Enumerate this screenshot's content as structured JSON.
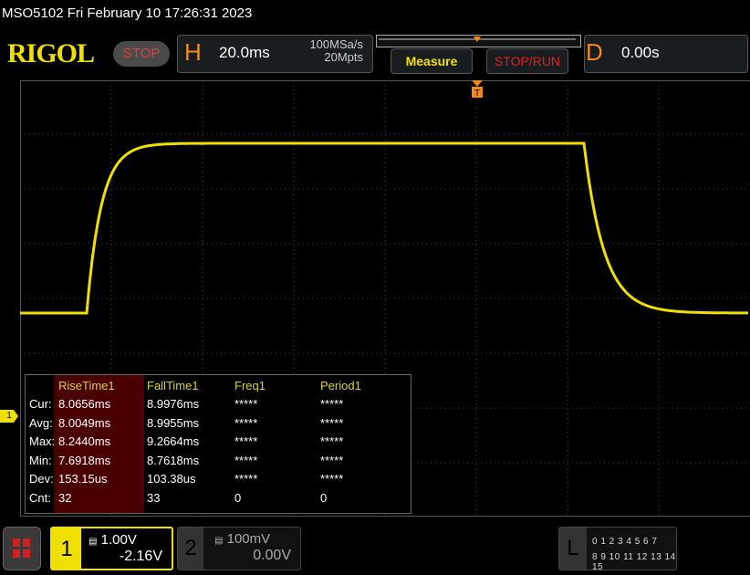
{
  "header": {
    "title": "MSO5102  Fri February 10 17:26:31 2023",
    "logo": "RIGOL",
    "run_state": "STOP"
  },
  "horizontal": {
    "label": "H",
    "timebase": "20.0ms",
    "sample_rate": "100MSa/s",
    "memory_depth": "20Mpts"
  },
  "buttons": {
    "measure": "Measure",
    "stop_run": "STOP/RUN"
  },
  "delay": {
    "label": "D",
    "value": "0.00s"
  },
  "trigger_marker": "T",
  "measurements": {
    "row_labels": [
      "Cur:",
      "Avg:",
      "Max:",
      "Min:",
      "Dev:",
      "Cnt:"
    ],
    "columns": [
      {
        "header": "RiseTime1",
        "values": [
          "8.0656ms",
          "8.0049ms",
          "8.2440ms",
          "7.6918ms",
          "153.15us",
          "32"
        ]
      },
      {
        "header": "FallTime1",
        "values": [
          "8.9976ms",
          "8.9955ms",
          "9.2664ms",
          "8.7618ms",
          "103.38us",
          "33"
        ]
      },
      {
        "header": "Freq1",
        "values": [
          "*****",
          "*****",
          "*****",
          "*****",
          "*****",
          "0"
        ]
      },
      {
        "header": "Period1",
        "values": [
          "*****",
          "*****",
          "*****",
          "*****",
          "*****",
          "0"
        ]
      }
    ]
  },
  "channels": [
    {
      "num": "1",
      "coupling_icon": "dc-coupling-icon",
      "scale": "1.00V",
      "offset": "-2.16V",
      "color": "#f0e000",
      "active": true
    },
    {
      "num": "2",
      "coupling_icon": "dc-coupling-icon",
      "scale": "100mV",
      "offset": "0.00V",
      "color": "#888888",
      "active": false
    }
  ],
  "ch1_marker": "1",
  "logic": {
    "label": "L",
    "row1": "0 1 2 3  4 5 6 7",
    "row2": "8 9 10 11 12 13 14 15"
  },
  "colors": {
    "trace": "#f0e000",
    "accent": "#f08a1c",
    "stop": "#e04040"
  }
}
